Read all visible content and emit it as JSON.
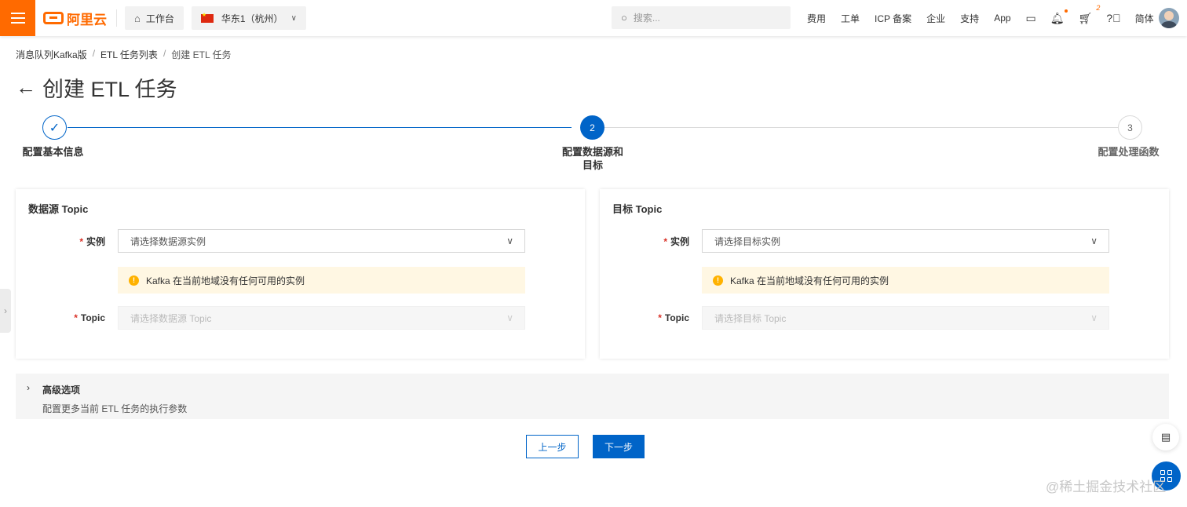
{
  "topbar": {
    "logo_text": "阿里云",
    "workbench_label": "工作台",
    "region_label": "华东1（杭州）",
    "search_placeholder": "搜索...",
    "nav": [
      "费用",
      "工单",
      "ICP 备案",
      "企业",
      "支持",
      "App"
    ],
    "cart_count": "2",
    "language": "简体"
  },
  "breadcrumb": {
    "items": [
      "消息队列Kafka版",
      "ETL 任务列表",
      "创建 ETL 任务"
    ],
    "separator": "/"
  },
  "page": {
    "title": "创建 ETL 任务"
  },
  "steps": [
    {
      "number": "1",
      "label": "配置基本信息",
      "status": "done"
    },
    {
      "number": "2",
      "label_line1": "配置数据源和",
      "label_line2": "目标",
      "status": "active"
    },
    {
      "number": "3",
      "label": "配置处理函数",
      "status": "pending"
    }
  ],
  "source": {
    "title": "数据源 Topic",
    "instance_label": "实例",
    "instance_placeholder": "请选择数据源实例",
    "warning": "Kafka 在当前地域没有任何可用的实例",
    "topic_label": "Topic",
    "topic_placeholder": "请选择数据源 Topic"
  },
  "target": {
    "title": "目标 Topic",
    "instance_label": "实例",
    "instance_placeholder": "请选择目标实例",
    "warning": "Kafka 在当前地域没有任何可用的实例",
    "topic_label": "Topic",
    "topic_placeholder": "请选择目标 Topic"
  },
  "advanced": {
    "title": "高级选项",
    "description": "配置更多当前 ETL 任务的执行参数"
  },
  "buttons": {
    "prev": "上一步",
    "next": "下一步"
  },
  "watermark": "@稀土掘金技术社区",
  "colors": {
    "brand": "#ff6a00",
    "primary": "#0064c8",
    "warning": "#ffb200"
  }
}
